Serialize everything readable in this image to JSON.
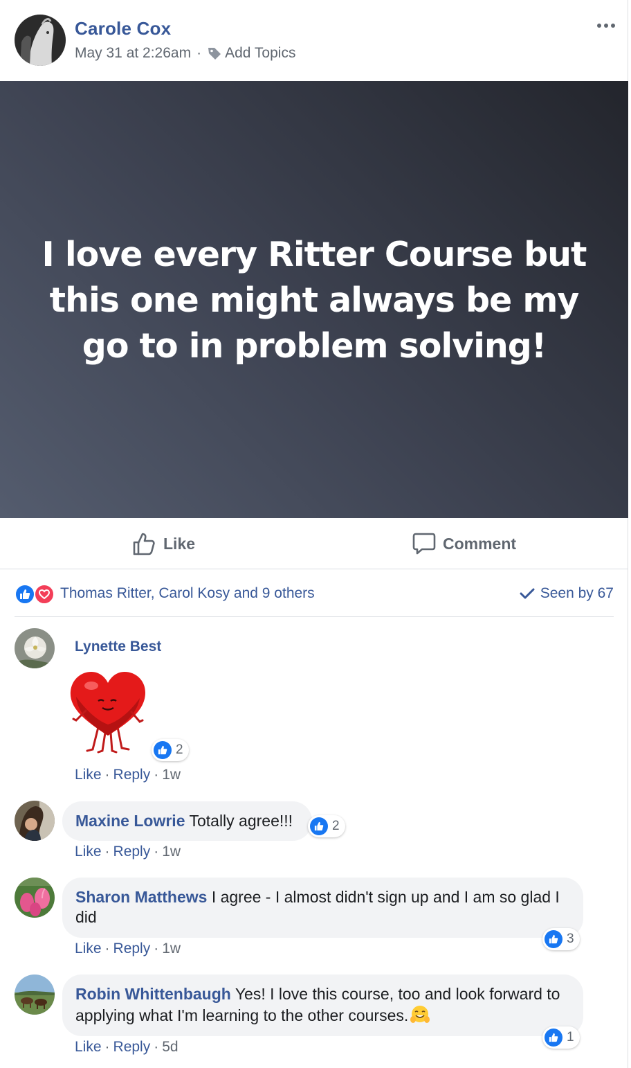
{
  "post": {
    "author": "Carole Cox",
    "timestamp": "May 31 at 2:26am",
    "meta_separator": "·",
    "add_topics_label": "Add Topics",
    "more_icon": "more-horizontal-icon",
    "hero_text": "I love every Ritter Course but this one might always be my go to in problem solving!",
    "hero_gradient": [
      "#545c6e",
      "#23252c"
    ]
  },
  "actions": {
    "like_label": "Like",
    "comment_label": "Comment"
  },
  "reactions": {
    "icons": [
      "like-reaction-icon",
      "love-reaction-icon"
    ],
    "reactors_text": "Thomas Ritter, Carol Kosy and 9 others",
    "seen_by": "Seen by 67"
  },
  "comments": [
    {
      "name": "Lynette Best",
      "text": "",
      "sticker": "heart-sticker",
      "likes": "2",
      "like_label": "Like",
      "reply_label": "Reply",
      "time": "1w"
    },
    {
      "name": "Maxine Lowrie",
      "text": "Totally agree!!!",
      "likes": "2",
      "like_label": "Like",
      "reply_label": "Reply",
      "time": "1w"
    },
    {
      "name": "Sharon Matthews",
      "text": "I agree - I almost didn't sign up and I am so glad I did",
      "likes": "3",
      "like_label": "Like",
      "reply_label": "Reply",
      "time": "1w"
    },
    {
      "name": "Robin Whittenbaugh",
      "text": "Yes! I love this course, too and look forward to applying what I'm learning to the other courses.",
      "emoji": "hugging-face-emoji",
      "likes": "1",
      "like_label": "Like",
      "reply_label": "Reply",
      "time": "5d"
    }
  ],
  "dot_separator": "·",
  "colors": {
    "link_blue": "#385898",
    "like_blue": "#1877f2",
    "love_red": "#f33e58",
    "muted_gray": "#606770",
    "bubble_gray": "#f2f3f5"
  }
}
